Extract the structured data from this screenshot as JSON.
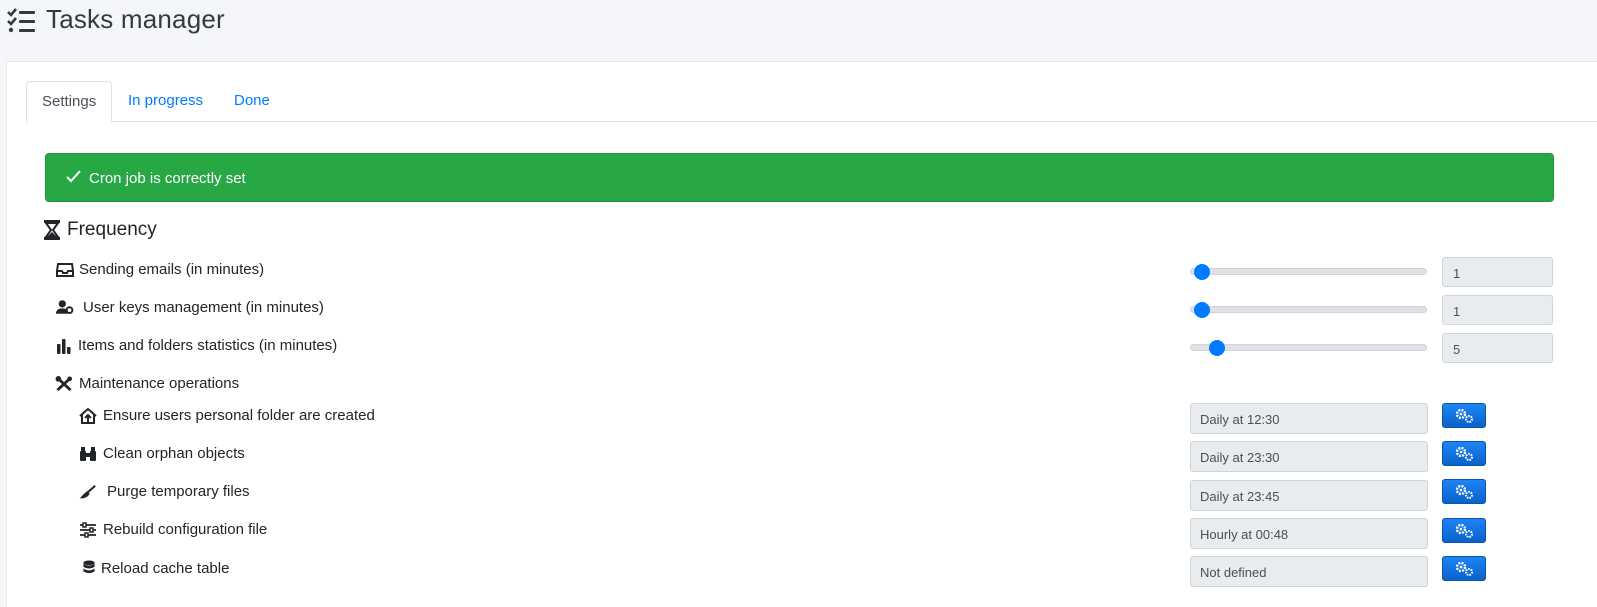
{
  "header": {
    "title": "Tasks manager",
    "icon": "tasks-list-icon"
  },
  "tabs": [
    {
      "label": "Settings",
      "active": true
    },
    {
      "label": "In progress",
      "active": false
    },
    {
      "label": "Done",
      "active": false
    }
  ],
  "alert": {
    "text": "Cron job is correctly set",
    "icon": "check-icon",
    "color": "#28a745"
  },
  "frequency": {
    "title": "Frequency",
    "icon": "hourglass-icon",
    "rows": [
      {
        "label": "Sending emails (in minutes)",
        "icon": "inbox-icon",
        "value": "1",
        "slider_fraction": 0.02
      },
      {
        "label": "User keys management (in minutes)",
        "icon": "user-gear-icon",
        "value": "1",
        "slider_fraction": 0.02
      },
      {
        "label": "Items and folders statistics (in minutes)",
        "icon": "bar-chart-icon",
        "value": "5",
        "slider_fraction": 0.08
      }
    ]
  },
  "maintenance": {
    "title": "Maintenance operations",
    "icon": "tools-icon",
    "rows": [
      {
        "label": "Ensure users personal folder are created",
        "icon": "house-user-icon",
        "schedule": "Daily at 12:30"
      },
      {
        "label": "Clean orphan objects",
        "icon": "binoculars-icon",
        "schedule": "Daily at 23:30"
      },
      {
        "label": "Purge temporary files",
        "icon": "broom-icon",
        "schedule": "Daily at 23:45"
      },
      {
        "label": "Rebuild configuration file",
        "icon": "sliders-icon",
        "schedule": "Hourly at 00:48"
      },
      {
        "label": "Reload cache table",
        "icon": "database-icon",
        "schedule": "Not defined"
      }
    ]
  },
  "colors": {
    "accent": "#007bff",
    "success": "#28a745",
    "button": "#0a62c9"
  }
}
